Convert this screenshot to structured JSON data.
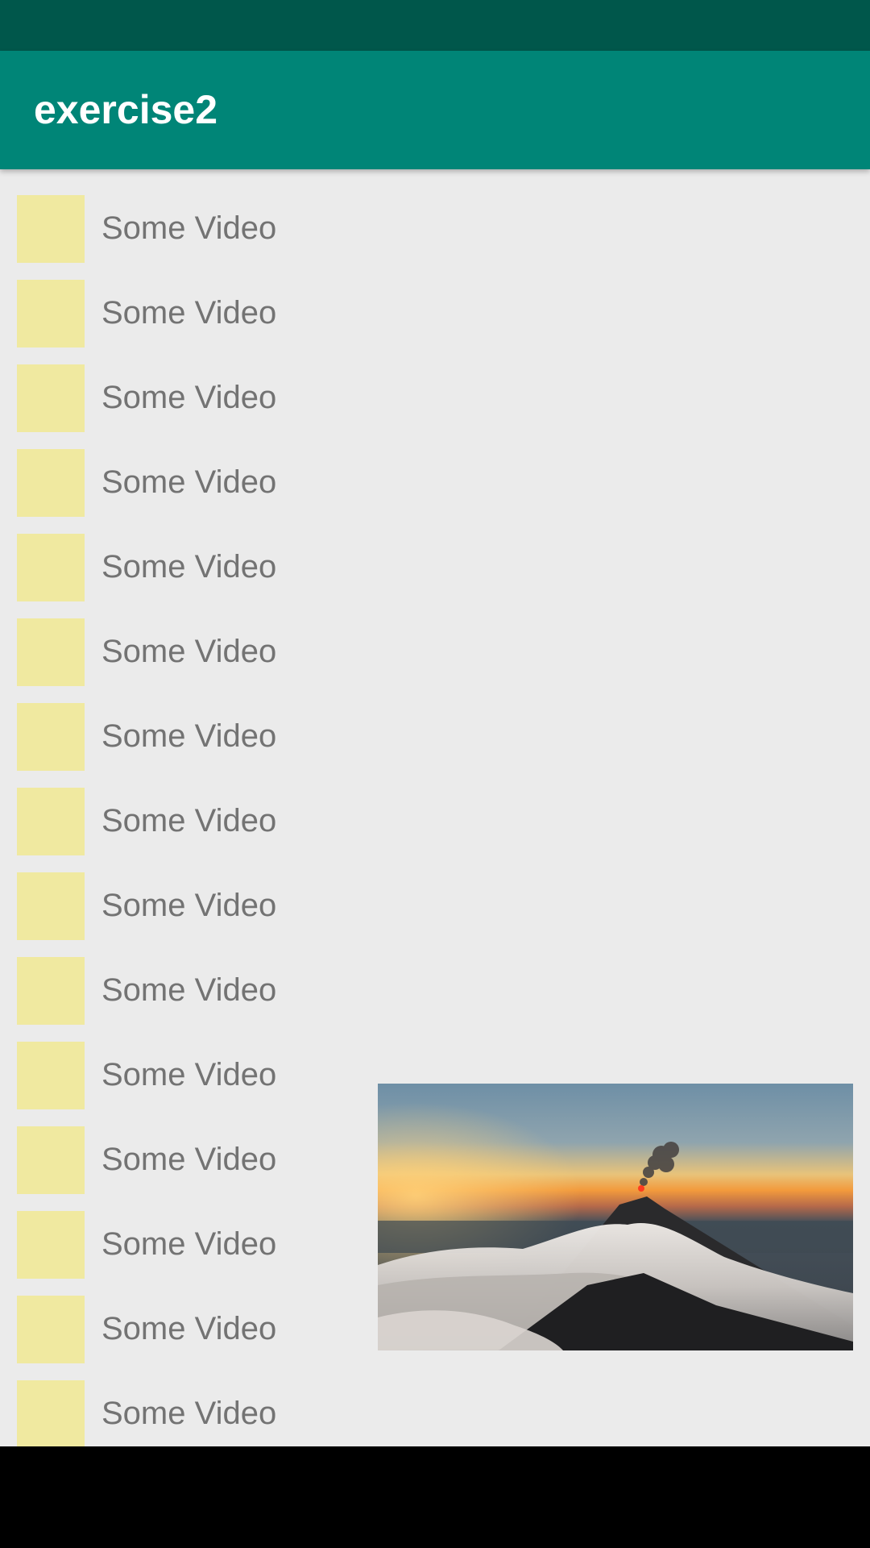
{
  "app": {
    "title": "exercise2",
    "colors": {
      "status_bar": "#00574B",
      "app_bar": "#008577",
      "content_bg": "#EBEBEB",
      "thumbnail": "#F0E9A0",
      "item_text": "#737373"
    }
  },
  "video_list": {
    "items": [
      {
        "label": "Some Video"
      },
      {
        "label": "Some Video"
      },
      {
        "label": "Some Video"
      },
      {
        "label": "Some Video"
      },
      {
        "label": "Some Video"
      },
      {
        "label": "Some Video"
      },
      {
        "label": "Some Video"
      },
      {
        "label": "Some Video"
      },
      {
        "label": "Some Video"
      },
      {
        "label": "Some Video"
      },
      {
        "label": "Some Video"
      },
      {
        "label": "Some Video"
      },
      {
        "label": "Some Video"
      },
      {
        "label": "Some Video"
      },
      {
        "label": "Some Video"
      }
    ]
  },
  "video_player": {
    "scene": "volcano-sunset-above-clouds"
  }
}
